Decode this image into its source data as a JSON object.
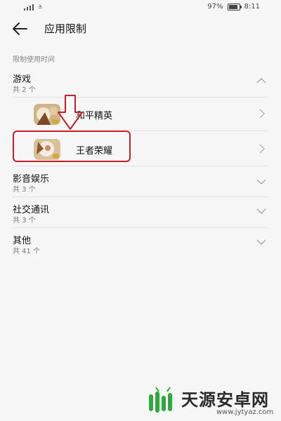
{
  "status_bar": {
    "battery": "97%",
    "battery_level": 0.97,
    "time": "8:11",
    "signal_text": "≚"
  },
  "header": {
    "title": "应用限制"
  },
  "section": {
    "label": "限制使用时间"
  },
  "groups": [
    {
      "title": "游戏",
      "count": "共 2 个",
      "expanded": true
    },
    {
      "title": "影音娱乐",
      "count": "共 3 个",
      "expanded": false
    },
    {
      "title": "社交通讯",
      "count": "共 3 个",
      "expanded": false
    },
    {
      "title": "其他",
      "count": "共 41 个",
      "expanded": false
    }
  ],
  "apps": [
    {
      "name": "和平精英"
    },
    {
      "name": "王者荣耀",
      "highlighted": true
    }
  ],
  "watermark": {
    "name": "天源安卓网",
    "url": "www.jytyaz.com"
  },
  "colors": {
    "highlight": "#c81e28",
    "logo_green": "#2eaa3c",
    "background": "#f6f6f6"
  }
}
